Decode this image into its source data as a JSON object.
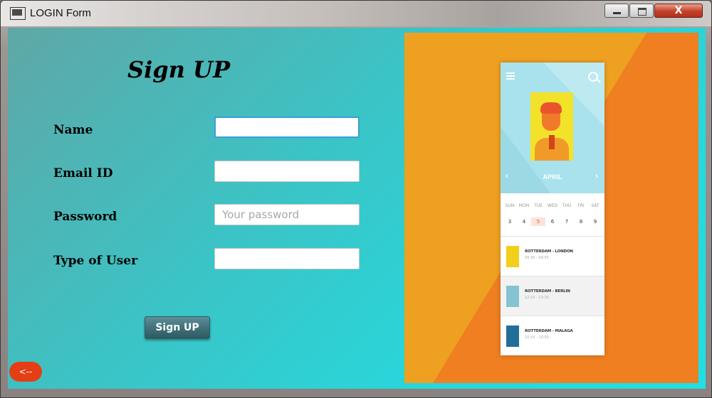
{
  "window": {
    "title": "LOGIN Form",
    "close_glyph": "X"
  },
  "form": {
    "heading": "Sign UP",
    "name_label": "Name",
    "email_label": "Email ID",
    "password_label": "Password",
    "password_placeholder": "Your password",
    "user_type_label": "Type of User",
    "signup_button": "Sign UP",
    "back_button": "<--"
  },
  "promo": {
    "colors": {
      "background": "#eea021",
      "diagonal": "#ef7f21"
    },
    "month": "APRIL",
    "prev_glyph": "‹",
    "next_glyph": "›",
    "days": [
      "SUN",
      "MON",
      "TUE",
      "WED",
      "THU",
      "FRI",
      "SAT"
    ],
    "dates": [
      "3",
      "4",
      "5",
      "6",
      "7",
      "8",
      "9"
    ],
    "highlighted_date": "5",
    "trips": [
      {
        "title": "ROTTERDAM - LONDON",
        "time": "09:35 - 09:55",
        "icon": "plane-icon",
        "color": "#f2cf1b"
      },
      {
        "title": "ROTTERDAM - BERLIN",
        "time": "12:10 - 13:30",
        "icon": "plane-icon",
        "color": "#86c3d0"
      },
      {
        "title": "ROTTERDAM - MALAGA",
        "time": "10:10 - 10:50",
        "icon": "plane-icon",
        "color": "#1f6f9a"
      }
    ]
  }
}
